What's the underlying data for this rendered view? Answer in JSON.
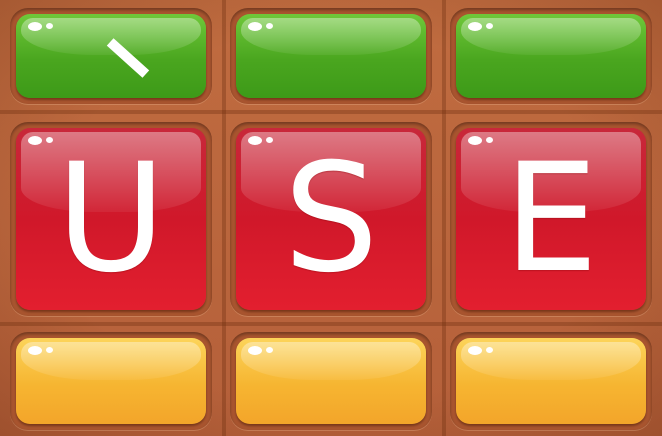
{
  "board": {
    "rows": [
      {
        "color": "#4aa61f",
        "tiles": [
          {
            "letter": "",
            "accent": "grave-accent-mark"
          },
          {
            "letter": ""
          },
          {
            "letter": ""
          }
        ]
      },
      {
        "color": "#d0182a",
        "tiles": [
          {
            "letter": "U"
          },
          {
            "letter": "S"
          },
          {
            "letter": "E"
          }
        ]
      },
      {
        "color": "#f6b531",
        "tiles": [
          {
            "letter": ""
          },
          {
            "letter": ""
          },
          {
            "letter": ""
          }
        ]
      }
    ],
    "board_color": "#b8643a"
  }
}
